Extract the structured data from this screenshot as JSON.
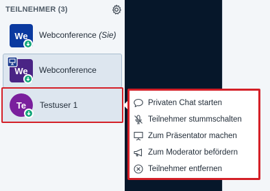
{
  "panel": {
    "title": "TEILNEHMER (3)",
    "settings_icon": "gear-icon"
  },
  "users": [
    {
      "initials": "We",
      "name": "Webconference",
      "suffix": "(Sie)",
      "avatar_color": "#0b3aa0",
      "shape": "square",
      "status": "green-indicator"
    },
    {
      "initials": "We",
      "name": "Webconference",
      "suffix": "",
      "avatar_color": "#4a2485",
      "shape": "square",
      "status": "green-indicator",
      "presenter": true
    },
    {
      "initials": "Te",
      "name": "Testuser 1",
      "suffix": "",
      "avatar_color": "#7a1f9d",
      "shape": "round",
      "status": "green-indicator"
    }
  ],
  "context_menu": {
    "items": [
      {
        "label": "Privaten Chat starten",
        "icon": "chat-bubble-icon"
      },
      {
        "label": "Teilnehmer stummschalten",
        "icon": "mic-off-icon"
      },
      {
        "label": "Zum Präsentator machen",
        "icon": "presentation-icon"
      },
      {
        "label": "Zum Moderator befördern",
        "icon": "megaphone-icon"
      },
      {
        "label": "Teilnehmer entfernen",
        "icon": "remove-circle-icon"
      }
    ]
  },
  "colors": {
    "panel_bg": "#f3f6f9",
    "dark_area": "#06172a",
    "highlight_border": "#d41f27",
    "status_green": "#12a67a",
    "selected_bg": "#dde6ef"
  }
}
